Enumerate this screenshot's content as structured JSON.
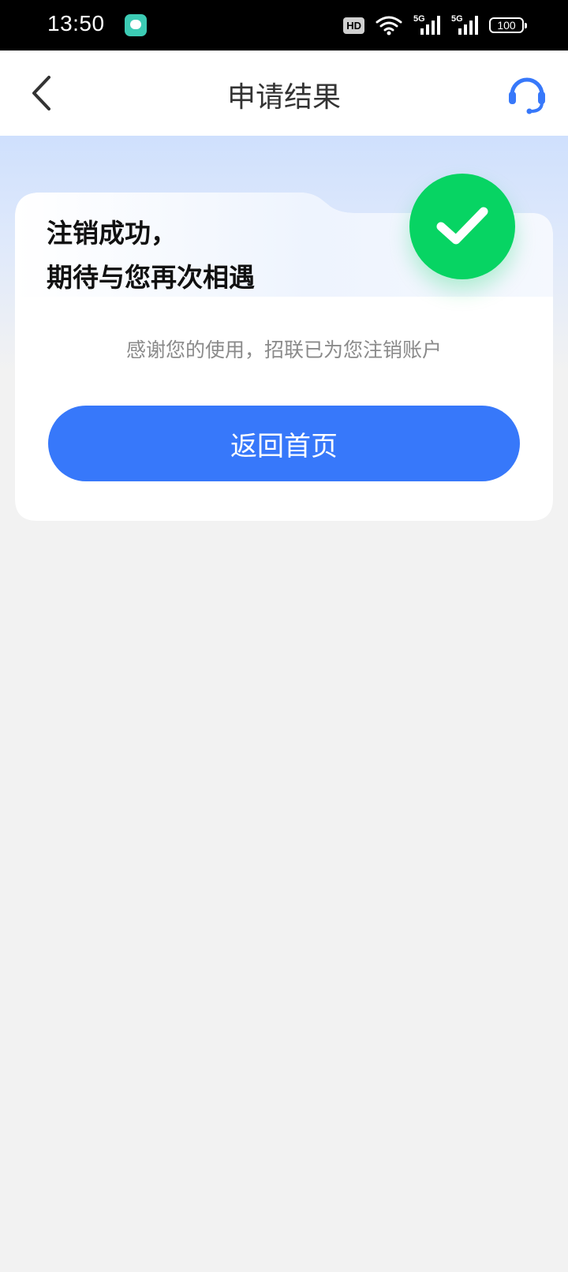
{
  "status_bar": {
    "time": "13:50",
    "network_badge": "HD",
    "signal_1_label": "5G",
    "signal_2_label": "5G",
    "battery": "100",
    "app_icon": "app-notification-icon",
    "wifi_icon": "wifi-icon"
  },
  "nav": {
    "title": "申请结果",
    "back_icon": "chevron-left-icon",
    "support_icon": "headset-icon"
  },
  "card": {
    "title_line1": "注销成功，",
    "title_line2": "期待与您再次相遇",
    "message": "感谢您的使用，招联已为您注销账户",
    "button_label": "返回首页",
    "badge_icon": "checkmark-icon"
  },
  "colors": {
    "accent": "#3778fa",
    "success": "#07d463",
    "support_icon": "#3778fa",
    "background": "#f2f2f2"
  }
}
